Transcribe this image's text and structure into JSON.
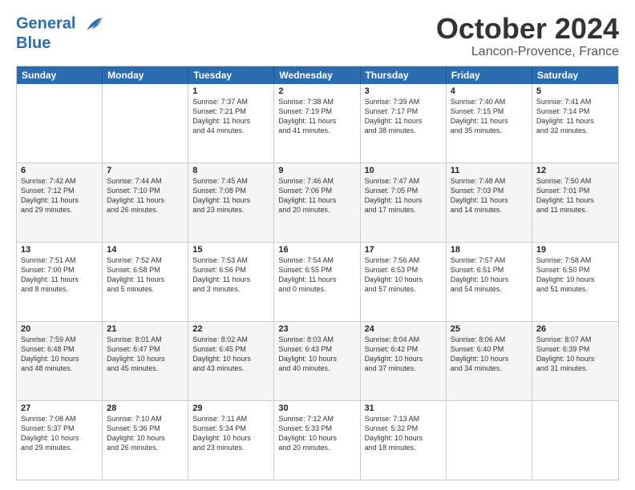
{
  "header": {
    "logo_line1": "General",
    "logo_line2": "Blue",
    "month": "October 2024",
    "location": "Lancon-Provence, France"
  },
  "weekdays": [
    "Sunday",
    "Monday",
    "Tuesday",
    "Wednesday",
    "Thursday",
    "Friday",
    "Saturday"
  ],
  "rows": [
    {
      "alt": false,
      "cells": [
        {
          "day": "",
          "info": ""
        },
        {
          "day": "",
          "info": ""
        },
        {
          "day": "1",
          "info": "Sunrise: 7:37 AM\nSunset: 7:21 PM\nDaylight: 11 hours\nand 44 minutes."
        },
        {
          "day": "2",
          "info": "Sunrise: 7:38 AM\nSunset: 7:19 PM\nDaylight: 11 hours\nand 41 minutes."
        },
        {
          "day": "3",
          "info": "Sunrise: 7:39 AM\nSunset: 7:17 PM\nDaylight: 11 hours\nand 38 minutes."
        },
        {
          "day": "4",
          "info": "Sunrise: 7:40 AM\nSunset: 7:15 PM\nDaylight: 11 hours\nand 35 minutes."
        },
        {
          "day": "5",
          "info": "Sunrise: 7:41 AM\nSunset: 7:14 PM\nDaylight: 11 hours\nand 32 minutes."
        }
      ]
    },
    {
      "alt": true,
      "cells": [
        {
          "day": "6",
          "info": "Sunrise: 7:42 AM\nSunset: 7:12 PM\nDaylight: 11 hours\nand 29 minutes."
        },
        {
          "day": "7",
          "info": "Sunrise: 7:44 AM\nSunset: 7:10 PM\nDaylight: 11 hours\nand 26 minutes."
        },
        {
          "day": "8",
          "info": "Sunrise: 7:45 AM\nSunset: 7:08 PM\nDaylight: 11 hours\nand 23 minutes."
        },
        {
          "day": "9",
          "info": "Sunrise: 7:46 AM\nSunset: 7:06 PM\nDaylight: 11 hours\nand 20 minutes."
        },
        {
          "day": "10",
          "info": "Sunrise: 7:47 AM\nSunset: 7:05 PM\nDaylight: 11 hours\nand 17 minutes."
        },
        {
          "day": "11",
          "info": "Sunrise: 7:48 AM\nSunset: 7:03 PM\nDaylight: 11 hours\nand 14 minutes."
        },
        {
          "day": "12",
          "info": "Sunrise: 7:50 AM\nSunset: 7:01 PM\nDaylight: 11 hours\nand 11 minutes."
        }
      ]
    },
    {
      "alt": false,
      "cells": [
        {
          "day": "13",
          "info": "Sunrise: 7:51 AM\nSunset: 7:00 PM\nDaylight: 11 hours\nand 8 minutes."
        },
        {
          "day": "14",
          "info": "Sunrise: 7:52 AM\nSunset: 6:58 PM\nDaylight: 11 hours\nand 5 minutes."
        },
        {
          "day": "15",
          "info": "Sunrise: 7:53 AM\nSunset: 6:56 PM\nDaylight: 11 hours\nand 3 minutes."
        },
        {
          "day": "16",
          "info": "Sunrise: 7:54 AM\nSunset: 6:55 PM\nDaylight: 11 hours\nand 0 minutes."
        },
        {
          "day": "17",
          "info": "Sunrise: 7:56 AM\nSunset: 6:53 PM\nDaylight: 10 hours\nand 57 minutes."
        },
        {
          "day": "18",
          "info": "Sunrise: 7:57 AM\nSunset: 6:51 PM\nDaylight: 10 hours\nand 54 minutes."
        },
        {
          "day": "19",
          "info": "Sunrise: 7:58 AM\nSunset: 6:50 PM\nDaylight: 10 hours\nand 51 minutes."
        }
      ]
    },
    {
      "alt": true,
      "cells": [
        {
          "day": "20",
          "info": "Sunrise: 7:59 AM\nSunset: 6:48 PM\nDaylight: 10 hours\nand 48 minutes."
        },
        {
          "day": "21",
          "info": "Sunrise: 8:01 AM\nSunset: 6:47 PM\nDaylight: 10 hours\nand 45 minutes."
        },
        {
          "day": "22",
          "info": "Sunrise: 8:02 AM\nSunset: 6:45 PM\nDaylight: 10 hours\nand 43 minutes."
        },
        {
          "day": "23",
          "info": "Sunrise: 8:03 AM\nSunset: 6:43 PM\nDaylight: 10 hours\nand 40 minutes."
        },
        {
          "day": "24",
          "info": "Sunrise: 8:04 AM\nSunset: 6:42 PM\nDaylight: 10 hours\nand 37 minutes."
        },
        {
          "day": "25",
          "info": "Sunrise: 8:06 AM\nSunset: 6:40 PM\nDaylight: 10 hours\nand 34 minutes."
        },
        {
          "day": "26",
          "info": "Sunrise: 8:07 AM\nSunset: 6:39 PM\nDaylight: 10 hours\nand 31 minutes."
        }
      ]
    },
    {
      "alt": false,
      "cells": [
        {
          "day": "27",
          "info": "Sunrise: 7:08 AM\nSunset: 5:37 PM\nDaylight: 10 hours\nand 29 minutes."
        },
        {
          "day": "28",
          "info": "Sunrise: 7:10 AM\nSunset: 5:36 PM\nDaylight: 10 hours\nand 26 minutes."
        },
        {
          "day": "29",
          "info": "Sunrise: 7:11 AM\nSunset: 5:34 PM\nDaylight: 10 hours\nand 23 minutes."
        },
        {
          "day": "30",
          "info": "Sunrise: 7:12 AM\nSunset: 5:33 PM\nDaylight: 10 hours\nand 20 minutes."
        },
        {
          "day": "31",
          "info": "Sunrise: 7:13 AM\nSunset: 5:32 PM\nDaylight: 10 hours\nand 18 minutes."
        },
        {
          "day": "",
          "info": ""
        },
        {
          "day": "",
          "info": ""
        }
      ]
    }
  ]
}
